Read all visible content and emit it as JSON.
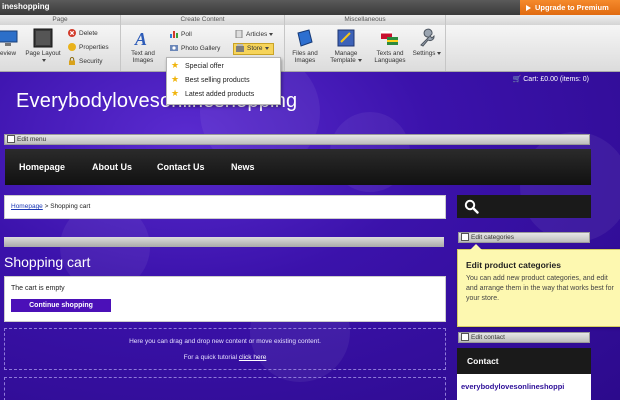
{
  "topbar": {
    "site_title": "ineshopping",
    "upgrade_label": "Upgrade to Premium"
  },
  "toolbar": {
    "groups": {
      "page": "Page",
      "create": "Create Content",
      "misc": "Miscellaneous"
    },
    "preview_label": "eview",
    "page_layout_label": "Page Layout",
    "delete_label": "Delete",
    "properties_label": "Properties",
    "security_label": "Security",
    "text_images_label": "Text and Images",
    "poll_label": "Poll",
    "photo_gallery_label": "Photo Gallery",
    "articles_label": "Articles",
    "store_label": "Store",
    "files_images_label": "Files and Images",
    "manage_template_label": "Manage Template",
    "texts_languages_label": "Texts and Languages",
    "settings_label": "Settings"
  },
  "store_menu": {
    "items": [
      "Special offer",
      "Best selling products",
      "Latest added products"
    ]
  },
  "site": {
    "name": "Everybodylovesonlineshopping",
    "cart_summary": "Cart: £0.00 (items: 0)",
    "edit_menu_label": "Edit menu",
    "nav": [
      "Homepage",
      "About Us",
      "Contact Us",
      "News"
    ],
    "breadcrumb": {
      "home": "Homepage",
      "sep": ">",
      "current": "Shopping cart"
    },
    "page_title": "Shopping cart",
    "cart_empty_text": "The cart is empty",
    "continue_label": "Continue shopping",
    "drop_line1": "Here you can drag and drop new content or move existing content.",
    "drop_line2_prefix": "For a quick tutorial",
    "drop_line2_link": "click here",
    "edit_categories_label": "Edit categories",
    "tooltip_title": "Edit product categories",
    "tooltip_text": "You can add new product categories, and edit and arrange them in the way that works best for your store.",
    "edit_contact_label": "Edit contact",
    "contact_title": "Contact",
    "contact_email": "everybodylovesonlineshoppi"
  },
  "colors": {
    "accent": "#4b10b8",
    "upgrade": "#e8791c",
    "background": "#3a10a8",
    "tooltip": "#fdf8b0"
  }
}
